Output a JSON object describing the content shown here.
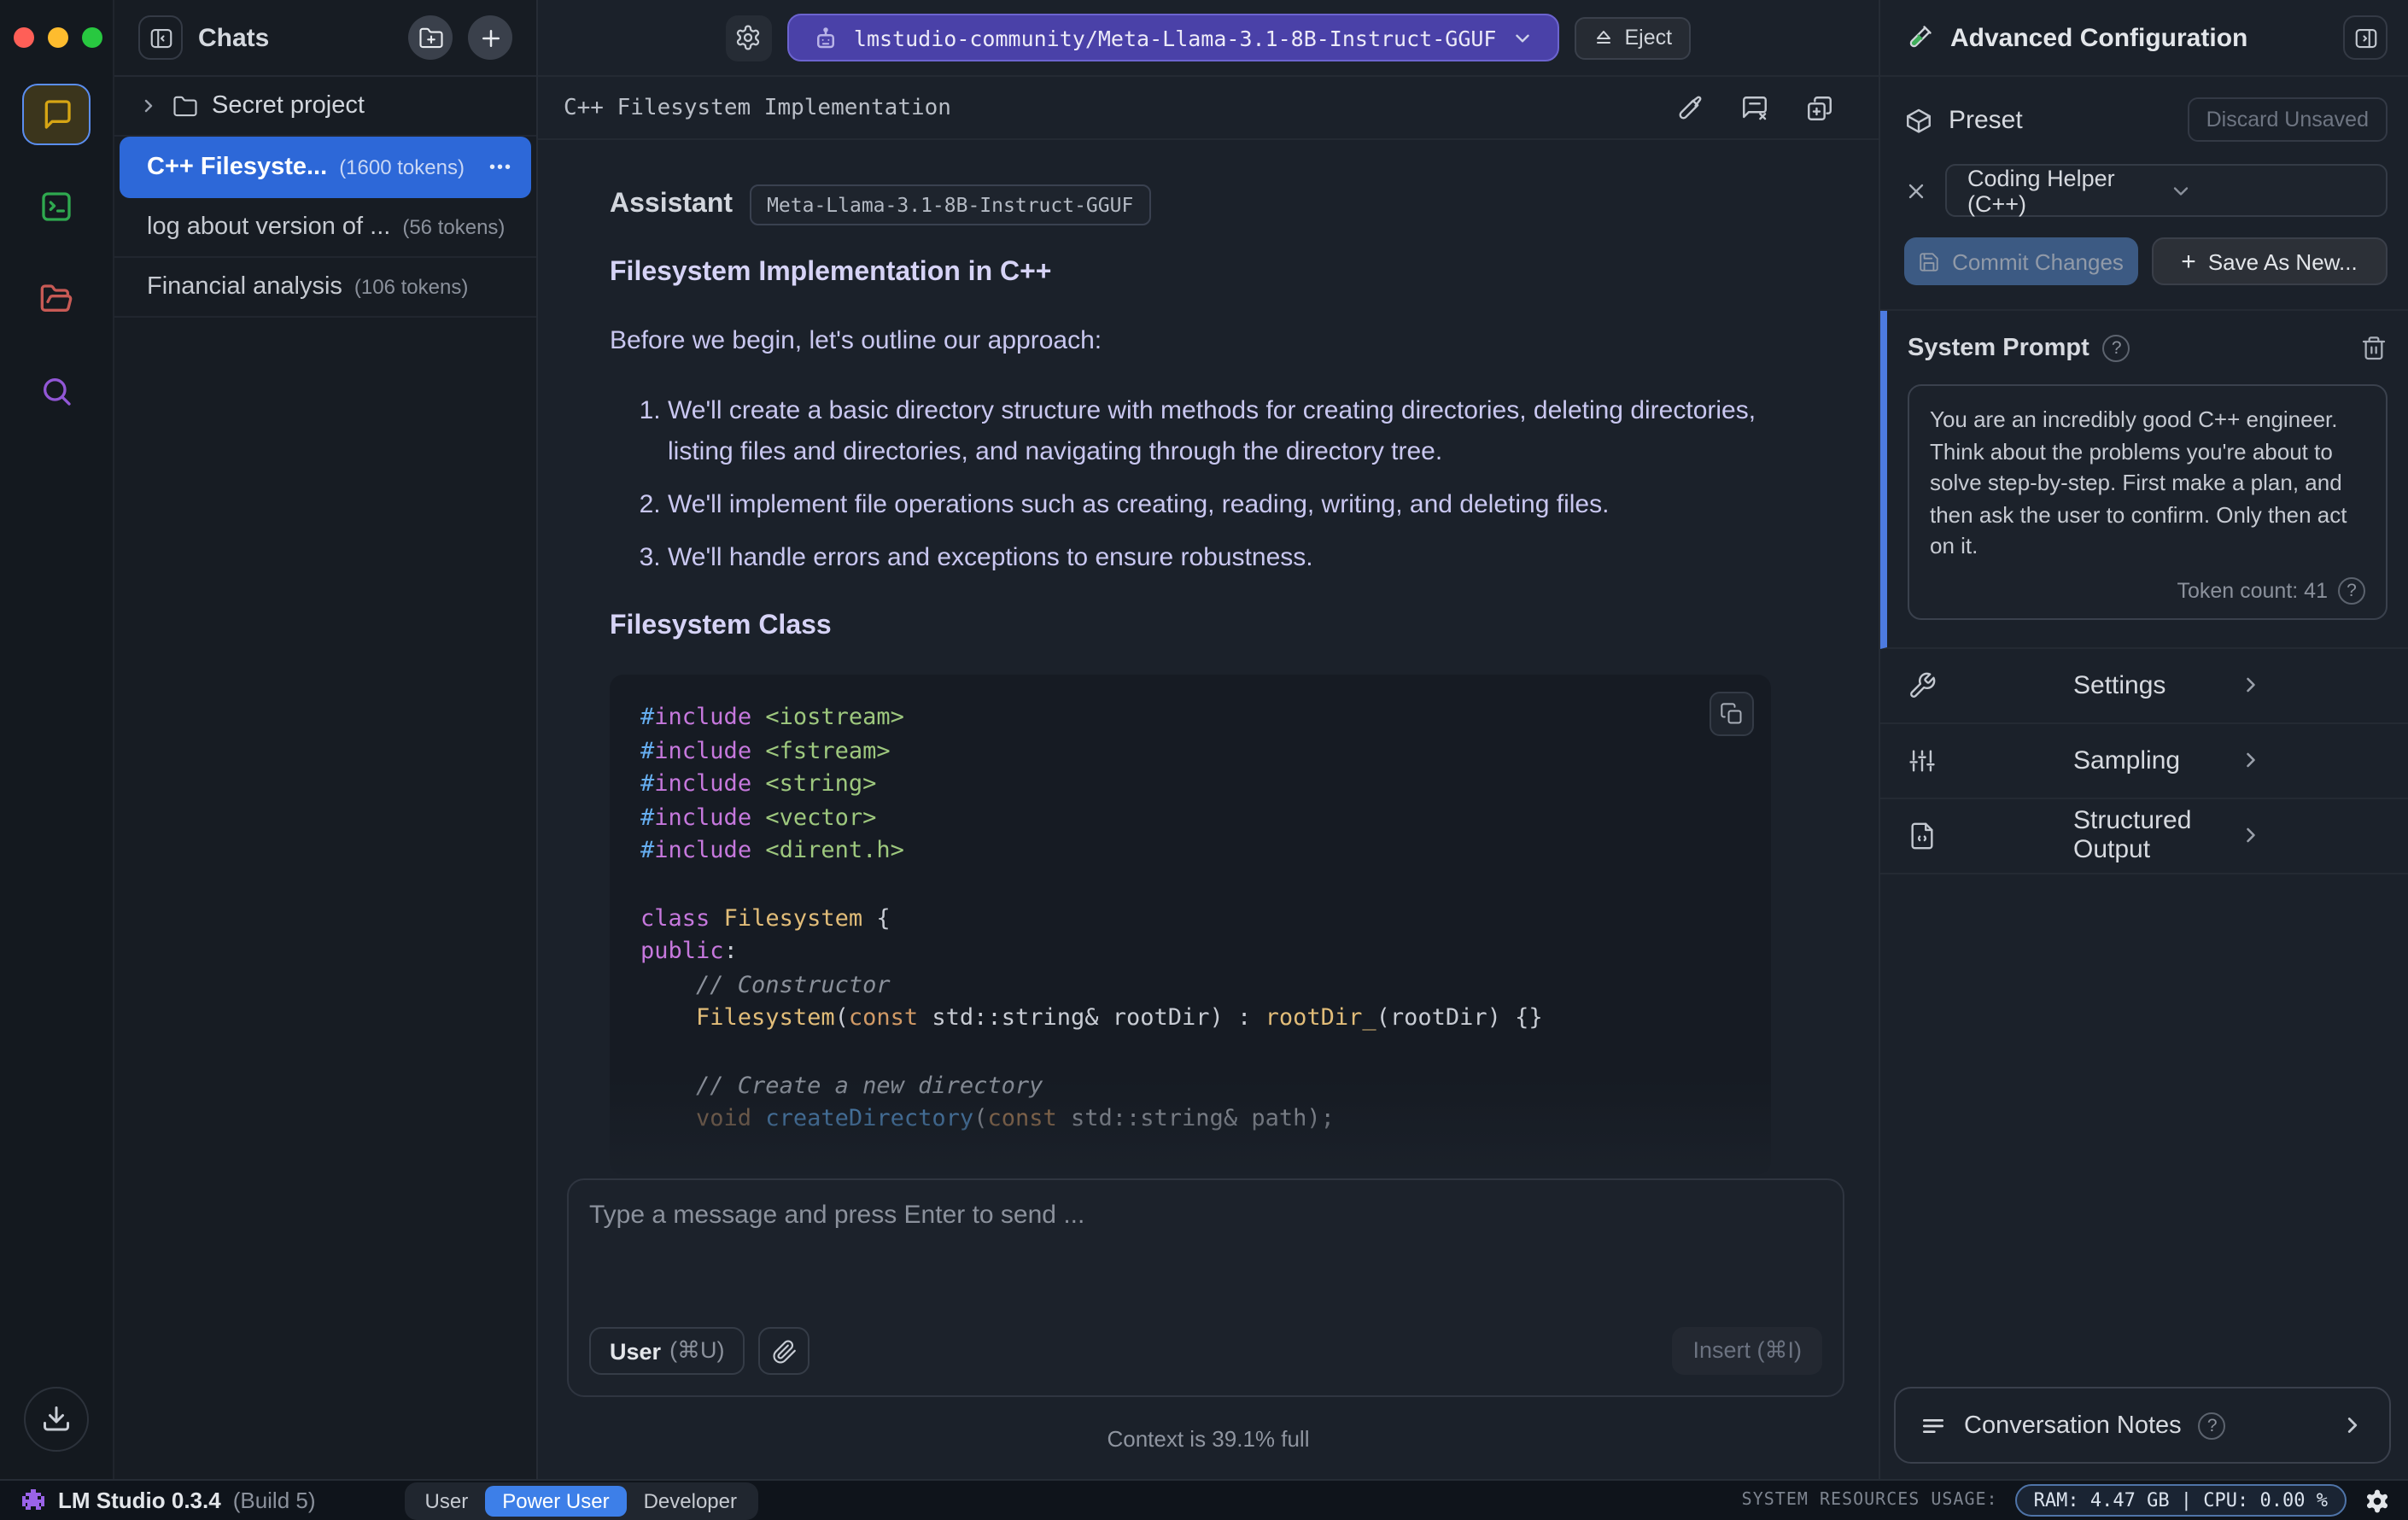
{
  "colors": {
    "accent_blue": "#2d68d8",
    "model_pill": "#4a41a8",
    "mode_active": "#3d7fe8",
    "sysprompt_accent": "#4d7be0",
    "rail_chat": "#d6a514",
    "rail_terminal": "#2fa94f",
    "rail_folder": "#c75a55",
    "rail_search": "#9257d6",
    "logo_purple": "#9a63e8"
  },
  "rail": {
    "items": [
      {
        "icon": "chat-bubble-icon",
        "active": true
      },
      {
        "icon": "terminal-icon",
        "active": false
      },
      {
        "icon": "folder-open-icon",
        "active": false
      },
      {
        "icon": "search-icon",
        "active": false
      }
    ],
    "bottom_icon": "download-icon"
  },
  "chats_panel": {
    "title": "Chats",
    "folder": {
      "name": "Secret project"
    },
    "items": [
      {
        "title": "C++ Filesyste...",
        "tokens": "(1600 tokens)",
        "menu": "•••",
        "selected": true
      },
      {
        "title": "log about version of ...",
        "tokens": "(56 tokens)",
        "selected": false
      },
      {
        "title": "Financial analysis",
        "tokens": "(106 tokens)",
        "selected": false
      }
    ]
  },
  "top_bar": {
    "model": "lmstudio-community/Meta-Llama-3.1-8B-Instruct-GGUF",
    "eject_label": "Eject"
  },
  "chat": {
    "title": "C++ Filesystem Implementation",
    "sender": "Assistant",
    "model_badge": "Meta-Llama-3.1-8B-Instruct-GGUF",
    "heading1": "Filesystem Implementation in C++",
    "intro": "Before we begin, let's outline our approach:",
    "list": [
      "We'll create a basic directory structure with methods for creating directories, deleting directories, listing files and directories, and navigating through the directory tree.",
      "We'll implement file operations such as creating, reading, writing, and deleting files.",
      "We'll handle errors and exceptions to ensure robustness."
    ],
    "heading2": "Filesystem Class"
  },
  "code": {
    "palette": {
      "mag": "#c678dd",
      "blu": "#66aef0",
      "grn": "#9ec87e",
      "yel": "#e2bd79",
      "org": "#d19a66",
      "gry": "#8b919b",
      "tan": "#b18a67",
      "wht": "#c8ccd4"
    },
    "lines": [
      {
        "tokens": [
          {
            "t": "#",
            "c": "blu"
          },
          {
            "t": "include",
            "c": "mag"
          },
          {
            "t": " "
          },
          {
            "t": "<iostream>",
            "c": "grn"
          }
        ]
      },
      {
        "tokens": [
          {
            "t": "#",
            "c": "blu"
          },
          {
            "t": "include",
            "c": "mag"
          },
          {
            "t": " "
          },
          {
            "t": "<fstream>",
            "c": "grn"
          }
        ]
      },
      {
        "tokens": [
          {
            "t": "#",
            "c": "blu"
          },
          {
            "t": "include",
            "c": "mag"
          },
          {
            "t": " "
          },
          {
            "t": "<string>",
            "c": "grn"
          }
        ]
      },
      {
        "tokens": [
          {
            "t": "#",
            "c": "blu"
          },
          {
            "t": "include",
            "c": "mag"
          },
          {
            "t": " "
          },
          {
            "t": "<vector>",
            "c": "grn"
          }
        ]
      },
      {
        "tokens": [
          {
            "t": "#",
            "c": "blu"
          },
          {
            "t": "include",
            "c": "mag"
          },
          {
            "t": " "
          },
          {
            "t": "<dirent.h>",
            "c": "grn"
          }
        ]
      },
      {
        "tokens": []
      },
      {
        "tokens": [
          {
            "t": "class",
            "c": "mag"
          },
          {
            "t": " "
          },
          {
            "t": "Filesystem",
            "c": "yel"
          },
          {
            "t": " {",
            "c": "wht"
          }
        ]
      },
      {
        "tokens": [
          {
            "t": "public",
            "c": "mag"
          },
          {
            "t": ":",
            "c": "wht"
          }
        ]
      },
      {
        "tokens": [
          {
            "t": "    "
          },
          {
            "t": "// Constructor",
            "c": "gry",
            "i": true
          }
        ]
      },
      {
        "tokens": [
          {
            "t": "    "
          },
          {
            "t": "Filesystem",
            "c": "yel"
          },
          {
            "t": "(",
            "c": "wht"
          },
          {
            "t": "const",
            "c": "org"
          },
          {
            "t": " std::string& rootDir",
            "c": "wht"
          },
          {
            "t": ") : ",
            "c": "wht"
          },
          {
            "t": "rootDir_",
            "c": "yel"
          },
          {
            "t": "(rootDir) {}",
            "c": "wht"
          }
        ]
      },
      {
        "tokens": []
      },
      {
        "tokens": [
          {
            "t": "    "
          },
          {
            "t": "// Create a new directory",
            "c": "gry",
            "i": true
          }
        ]
      },
      {
        "dim": true,
        "tokens": [
          {
            "t": "    "
          },
          {
            "t": "void",
            "c": "tan"
          },
          {
            "t": " "
          },
          {
            "t": "createDirectory",
            "c": "blu"
          },
          {
            "t": "(",
            "c": "wht"
          },
          {
            "t": "const",
            "c": "org"
          },
          {
            "t": " std::string& path);",
            "c": "wht"
          }
        ]
      }
    ]
  },
  "input": {
    "placeholder": "Type a message and press Enter to send ...",
    "user_button": "User",
    "user_shortcut": "(⌘U)",
    "insert_label": "Insert (⌘I)",
    "context_status": "Context is 39.1% full"
  },
  "right_panel": {
    "title": "Advanced Configuration",
    "preset": {
      "label": "Preset",
      "discard_label": "Discard Unsaved",
      "value": "Coding Helper (C++)",
      "commit_label": "Commit Changes",
      "save_as_new_label": "Save As New...",
      "plus": "+"
    },
    "system_prompt": {
      "label": "System Prompt",
      "text": "You are an incredibly good C++ engineer. Think about the problems you're about to solve step-by-step. First make a plan, and then ask the user to confirm. Only then act on it.",
      "token_count": "Token count: 41"
    },
    "sections": [
      {
        "label": "Settings",
        "icon": "wrench-icon"
      },
      {
        "label": "Sampling",
        "icon": "sliders-icon"
      },
      {
        "label": "Structured Output",
        "icon": "file-code-icon"
      }
    ],
    "notes_label": "Conversation Notes"
  },
  "status_bar": {
    "app": "LM Studio 0.3.4",
    "build": "(Build 5)",
    "modes": [
      "User",
      "Power User",
      "Developer"
    ],
    "active_mode": "Power User",
    "resources_label": "SYSTEM RESOURCES USAGE:",
    "resources_value": "RAM: 4.47 GB | CPU: 0.00 %"
  }
}
